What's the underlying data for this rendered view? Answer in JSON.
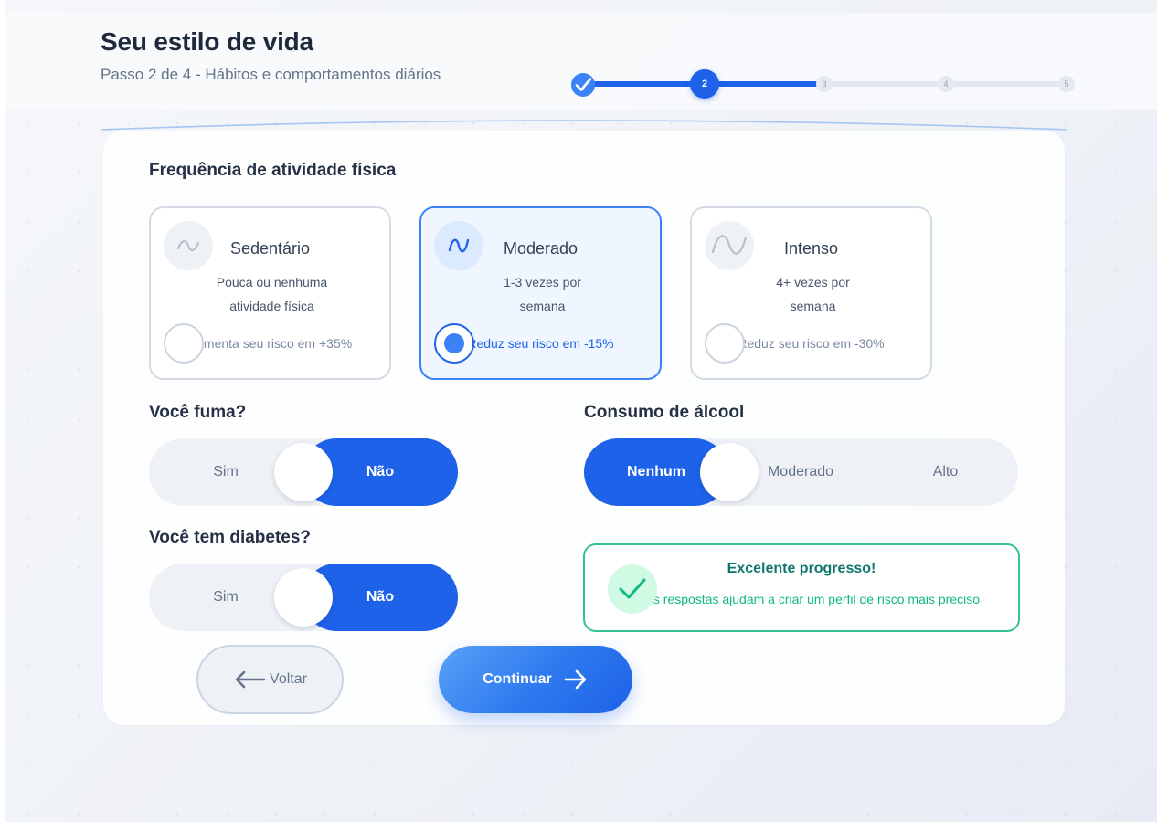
{
  "header": {
    "title": "Seu estilo de vida",
    "subtitle": "Passo 2 de 4 - Hábitos e comportamentos diários"
  },
  "stepper": {
    "steps": [
      "",
      "2",
      "3",
      "4",
      "5"
    ],
    "current_step": 2,
    "completed_icon": "check-icon"
  },
  "activity": {
    "heading": "Frequência de atividade física",
    "selected": "Moderado",
    "options": [
      {
        "title": "Sedentário",
        "desc_line1": "Pouca ou nenhuma",
        "desc_line2": "atividade física",
        "risk": "Aumenta seu risco em +35%",
        "icon": "wave-icon"
      },
      {
        "title": "Moderado",
        "desc_line1": "1-3 vezes por",
        "desc_line2": "semana",
        "risk": "Reduz seu risco em -15%",
        "icon": "wave-icon"
      },
      {
        "title": "Intenso",
        "desc_line1": "4+ vezes por",
        "desc_line2": "semana",
        "risk": "Reduz seu risco em -30%",
        "icon": "wave-icon"
      }
    ]
  },
  "smoking": {
    "heading": "Você fuma?",
    "options": [
      "Sim",
      "Não"
    ],
    "selected": "Não"
  },
  "alcohol": {
    "heading": "Consumo de álcool",
    "options": [
      "Nenhum",
      "Moderado",
      "Alto"
    ],
    "selected": "Nenhum"
  },
  "diabetes": {
    "heading": "Você tem diabetes?",
    "options": [
      "Sim",
      "Não"
    ],
    "selected": "Não"
  },
  "notice": {
    "title": "Excelente progresso!",
    "text": "Suas respostas ajudam a criar um perfil de risco mais preciso",
    "icon": "check-icon"
  },
  "actions": {
    "back_label": "Voltar",
    "continue_label": "Continuar",
    "back_icon": "arrow-left-icon",
    "continue_icon": "arrow-right-icon"
  },
  "colors": {
    "primary": "#1d62e8",
    "success": "#34c38f",
    "heading": "#1e293b"
  }
}
